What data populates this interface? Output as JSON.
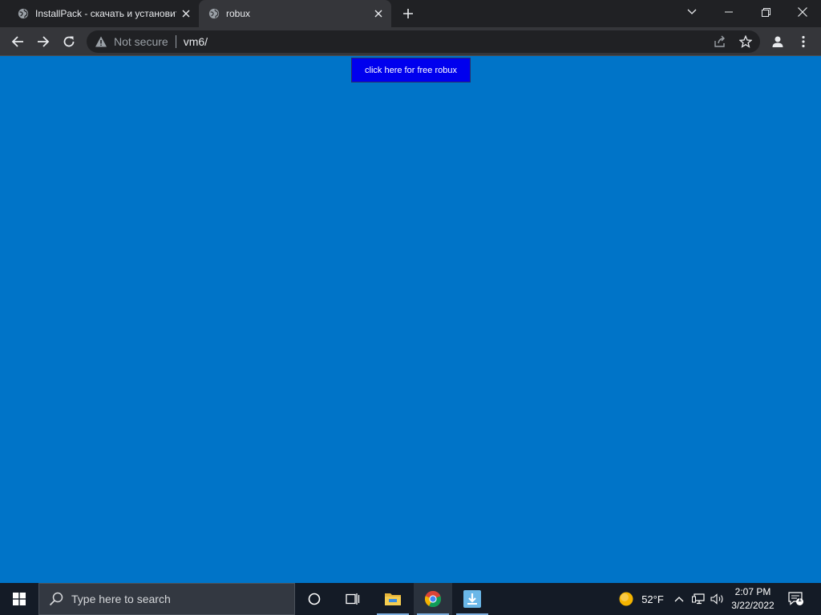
{
  "browser": {
    "tabs": [
      {
        "title": "InstallPack - скачать и установит",
        "active": false
      },
      {
        "title": "robux",
        "active": true
      }
    ],
    "omnibox": {
      "security_label": "Not secure",
      "url": "vm6/"
    }
  },
  "page": {
    "background_color": "#0074c8",
    "button_label": "click here for free robux",
    "button_color": "#0000ee"
  },
  "taskbar": {
    "search_placeholder": "Type here to search",
    "pinned_apps": [
      "task-view",
      "file-explorer",
      "chrome",
      "installpack"
    ],
    "weather_temp": "52°F",
    "time": "2:07 PM",
    "date": "3/22/2022",
    "notification_count": "1"
  }
}
